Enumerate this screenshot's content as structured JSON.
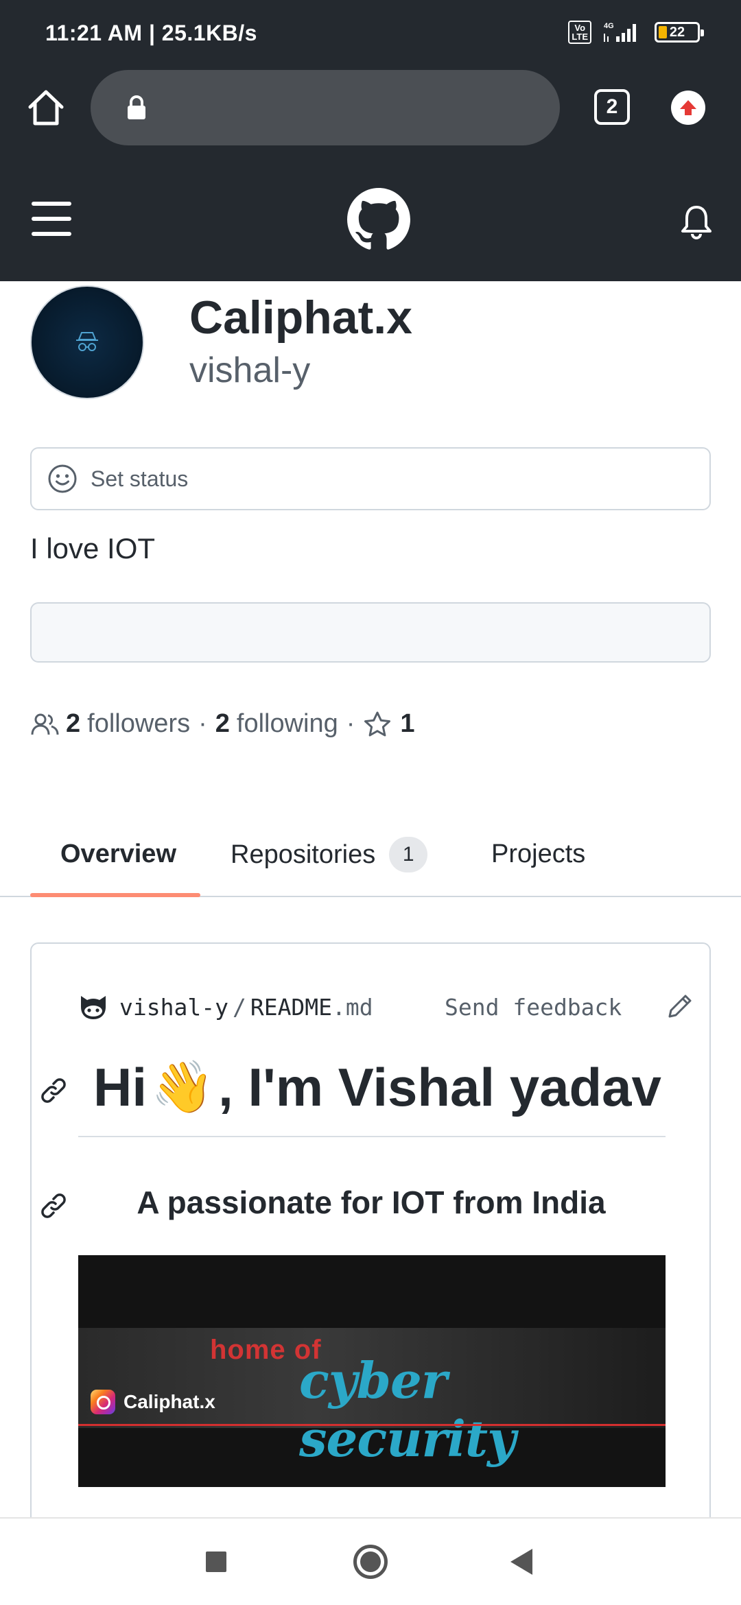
{
  "status_bar": {
    "time": "11:21 AM | 25.1KB/s",
    "network": "4G",
    "volte": "Vo LTE",
    "battery": "22"
  },
  "browser": {
    "tab_count": "2",
    "url": ""
  },
  "profile": {
    "name": "Caliphat.x",
    "login": "vishal-y",
    "set_status_label": "Set status",
    "bio": "I love IOT",
    "followers_count": "2",
    "followers_label": "followers",
    "following_count": "2",
    "following_label": "following",
    "stars_count": "1",
    "separator": "·"
  },
  "tabs": {
    "overview": "Overview",
    "repositories": "Repositories",
    "repositories_count": "1",
    "projects": "Projects"
  },
  "readme": {
    "owner": "vishal-y",
    "separator": "/",
    "file_base": "README",
    "file_ext": ".md",
    "send_feedback": "Send feedback",
    "heading_start": "Hi",
    "heading_emoji": "👋",
    "heading_end": ", I'm Vishal yadav",
    "subheading": "A passionate for IOT from India",
    "banner": {
      "line1": "home of",
      "line2": "cyber security",
      "handle": "Caliphat.x"
    }
  },
  "colors": {
    "header_bg": "#24292f",
    "tab_underline": "#fd8c73",
    "update_icon": "#e53935"
  }
}
